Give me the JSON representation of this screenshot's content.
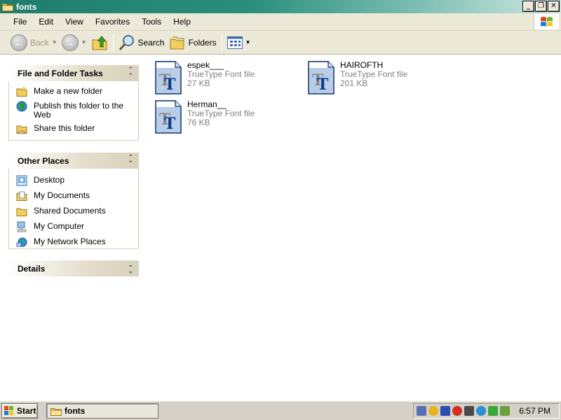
{
  "window": {
    "title": "fonts",
    "minimize": "_",
    "maximize": "❐",
    "close": "✕"
  },
  "menu": [
    "File",
    "Edit",
    "View",
    "Favorites",
    "Tools",
    "Help"
  ],
  "toolbar": {
    "back_label": "Back",
    "search_label": "Search",
    "folders_label": "Folders"
  },
  "panels": {
    "file_tasks": {
      "title": "File and Folder Tasks",
      "items": [
        "Make a new folder",
        "Publish this folder to the Web",
        "Share this folder"
      ]
    },
    "other_places": {
      "title": "Other Places",
      "items": [
        "Desktop",
        "My Documents",
        "Shared Documents",
        "My Computer",
        "My Network Places"
      ]
    },
    "details": {
      "title": "Details"
    }
  },
  "files": [
    {
      "name": "espek___",
      "type": "TrueType Font file",
      "size": "27 KB"
    },
    {
      "name": "HAIROFTH",
      "type": "TrueType Font file",
      "size": "201 KB"
    },
    {
      "name": "Herman__",
      "type": "TrueType Font file",
      "size": "76 KB"
    }
  ],
  "taskbar": {
    "start_label": "Start",
    "task_label": "fonts",
    "clock": "6:57 PM"
  },
  "colors": {
    "titlebar": "#1f7c6c",
    "panel_header": "#d8d2bd",
    "chrome": "#ece9d8"
  }
}
